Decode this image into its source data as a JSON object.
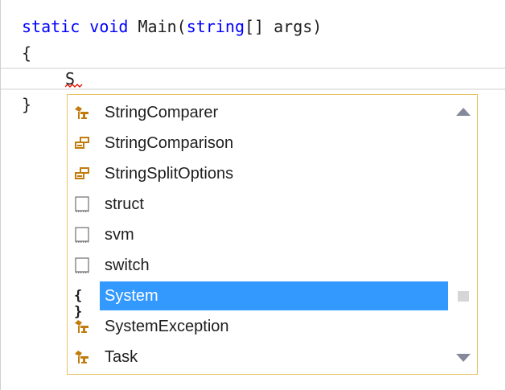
{
  "editor": {
    "line1": {
      "kw_static": "static",
      "kw_void": "void",
      "method_sig": "Main(",
      "kw_string": "string",
      "params": "[] args)"
    },
    "open_brace": "{",
    "typed_text": "S",
    "close_brace": "}"
  },
  "completion": {
    "items": [
      {
        "label": "StringComparer",
        "icon": "class-icon"
      },
      {
        "label": "StringComparison",
        "icon": "enum-icon"
      },
      {
        "label": "StringSplitOptions",
        "icon": "enum-icon"
      },
      {
        "label": "struct",
        "icon": "snippet-icon"
      },
      {
        "label": "svm",
        "icon": "snippet-icon"
      },
      {
        "label": "switch",
        "icon": "snippet-icon"
      },
      {
        "label": "System",
        "icon": "namespace-icon",
        "selected": true
      },
      {
        "label": "SystemException",
        "icon": "class-icon"
      },
      {
        "label": "Task",
        "icon": "class-icon"
      }
    ],
    "namespace_glyph": "{ }"
  },
  "colors": {
    "keyword": "#0000ff",
    "selection": "#3399ff",
    "popup_border": "#e5c365",
    "class_icon": "#c27c0e",
    "enum_icon": "#c27c0e",
    "squiggle": "#e51400"
  }
}
